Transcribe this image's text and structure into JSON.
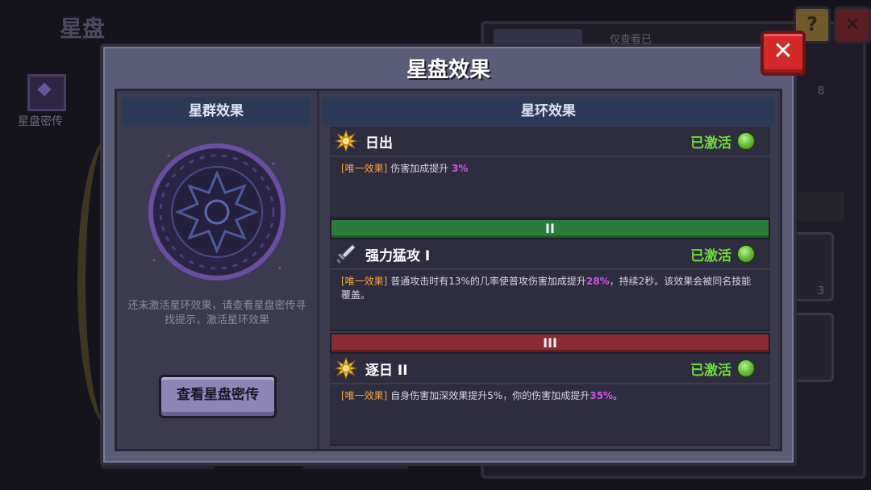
{
  "background": {
    "title": "星盘",
    "left_label": "星盘密传",
    "help_label": "?",
    "close_label": "✕",
    "tab_right_label": "仅查看已",
    "slot_numbers": [
      "8",
      "3"
    ]
  },
  "dialog": {
    "title": "星盘效果",
    "close_label": "✕"
  },
  "left_panel": {
    "header": "星群效果",
    "hint": "还未激活星环效果，请查看星盘密传寻找提示，激活星环效果",
    "button_label": "查看星盘密传"
  },
  "right_panel": {
    "header": "星环效果",
    "effects": [
      {
        "name": "日出",
        "icon": "sun-icon",
        "status": "已激活",
        "tag": "[唯一效果]",
        "desc_before": "伤害加成提升 ",
        "highlight": "3%",
        "desc_after": ""
      },
      {
        "name": "强力猛攻 I",
        "icon": "sword-icon",
        "status": "已激活",
        "tag": "[唯一效果]",
        "desc_before": "普通攻击时有13%的几率使普攻伤害加成提升",
        "highlight": "28%",
        "desc_after": "，持续2秒。该效果会被同名技能覆盖。"
      },
      {
        "name": "逐日 II",
        "icon": "sun-icon",
        "status": "已激活",
        "tag": "[唯一效果]",
        "desc_before": "自身伤害加深效果提升5%，你的伤害加成提升",
        "highlight": "35%",
        "desc_after": "。"
      }
    ],
    "tiers": [
      {
        "label": "II",
        "color": "#2c7d3b"
      },
      {
        "label": "III",
        "color": "#8c2a33"
      }
    ]
  },
  "colors": {
    "active_green": "#6fdc3c",
    "tag_orange": "#f5a33d",
    "highlight_purple": "#d455e6",
    "close_red": "#d32a2a"
  }
}
